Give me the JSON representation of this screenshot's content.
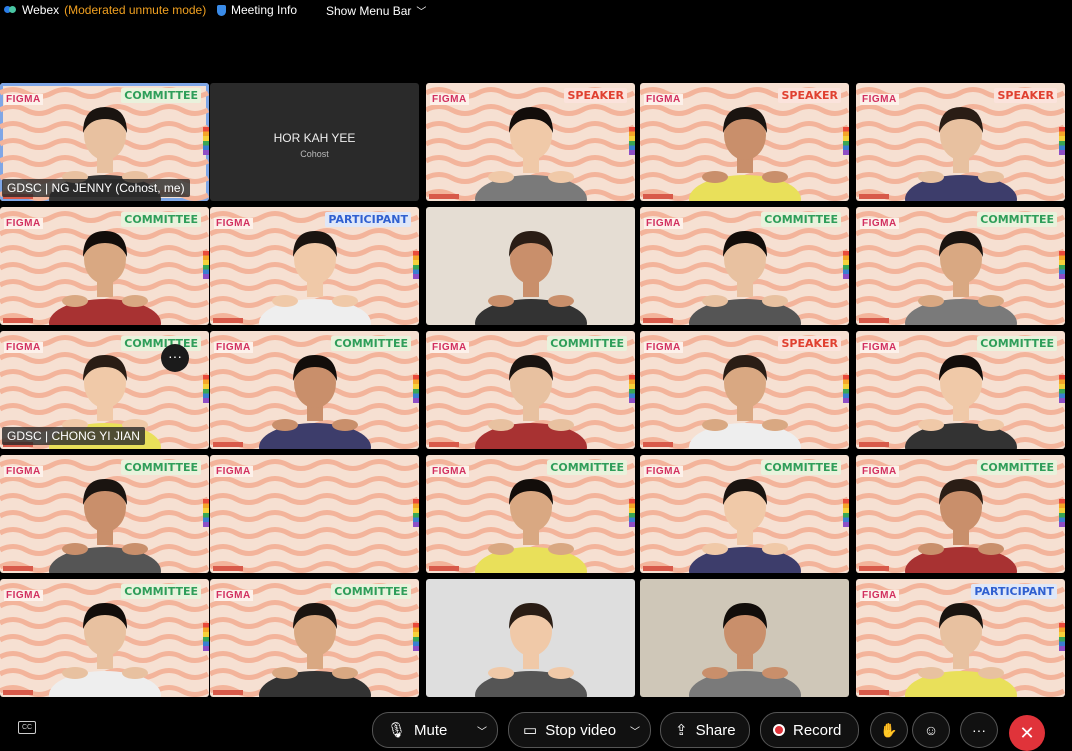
{
  "topbar": {
    "app_name": "Webex",
    "mode": "(Moderated unmute mode)",
    "meeting_info": "Meeting Info",
    "show_menu_bar": "Show Menu Bar"
  },
  "tiles": [
    {
      "caption": "GDSC | NG JENNY (Cohost, me)",
      "tag": "COMMITTEE"
    },
    {
      "name": "HOR KAH YEE",
      "role": "Cohost"
    },
    {
      "tag": "SPEAKER"
    },
    {
      "tag": "SPEAKER"
    },
    {
      "tag": "SPEAKER"
    },
    {
      "tag": "COMMITTEE"
    },
    {
      "tag": "PARTICIPANT"
    },
    {},
    {
      "tag": "COMMITTEE"
    },
    {
      "tag": "COMMITTEE"
    },
    {
      "caption": "GDSC | CHONG YI JIAN",
      "tag": "COMMITTEE"
    },
    {
      "tag": "COMMITTEE"
    },
    {
      "tag": "COMMITTEE"
    },
    {
      "tag": "SPEAKER"
    },
    {
      "tag": "COMMITTEE"
    },
    {
      "tag": "COMMITTEE"
    },
    {},
    {
      "tag": "COMMITTEE"
    },
    {
      "tag": "COMMITTEE"
    },
    {
      "tag": "COMMITTEE"
    },
    {
      "tag": "COMMITTEE"
    },
    {
      "tag": "COMMITTEE"
    },
    {},
    {},
    {
      "tag": "PARTICIPANT"
    }
  ],
  "figma_label": "FIGMA",
  "more_options": "···",
  "controls": {
    "mute": "Mute",
    "stop_video": "Stop video",
    "share": "Share",
    "record": "Record",
    "more": "···",
    "cc": "CC",
    "end": "✕"
  }
}
